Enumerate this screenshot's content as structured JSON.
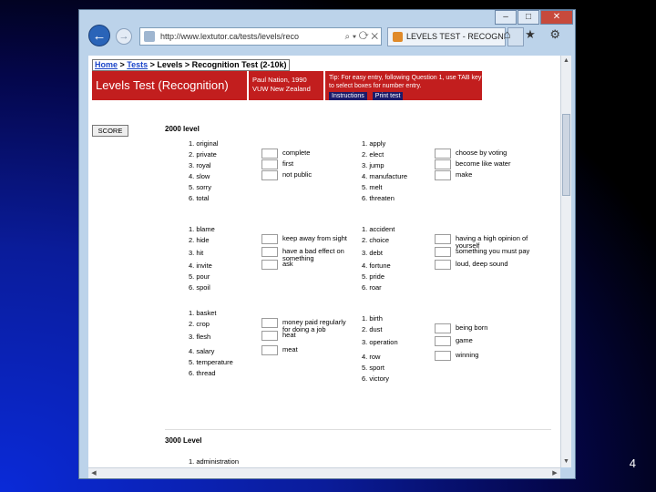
{
  "browser": {
    "caption_buttons": [
      "–",
      "□",
      "✕"
    ],
    "url": "http://www.lextutor.ca/tests/levels/reco",
    "tab_title": "LEVELS TEST - RECOGNI...",
    "tool_icons": "⌂ ★ ⚙"
  },
  "page": {
    "breadcrumb": {
      "home": "Home",
      "tests": "Tests",
      "sep": " > ",
      "rest": "Levels > Recognition Test (2-10k)"
    },
    "title": "Levels Test (Recognition)",
    "author_line1": "Paul Nation, 1990",
    "author_line2": "VUW New Zealand",
    "tip_text": "Tip: For easy entry, following Question 1, use TAB key to select boxes for number entry.",
    "tip_buttons": [
      "Instructions",
      "Print test"
    ],
    "score_button": "SCORE",
    "level1_heading": "2000 level",
    "level2_heading": "3000 Level",
    "level2_first_item": "1. administration"
  },
  "groups": [
    {
      "left_words": [
        "1. original",
        "2. private",
        "3. royal",
        "4. slow",
        "5. sorry",
        "6. total"
      ],
      "left_defs": [
        "complete",
        "first",
        "not public"
      ],
      "right_words": [
        "1. apply",
        "2. elect",
        "3. jump",
        "4. manufacture",
        "5. melt",
        "6. threaten"
      ],
      "right_defs": [
        "choose by voting",
        "become like water",
        "make"
      ]
    },
    {
      "left_words": [
        "1. blame",
        "2. hide",
        "3. hit",
        "4. invite",
        "5. pour",
        "6. spoil"
      ],
      "left_defs": [
        "keep away from sight",
        "have a bad effect on something",
        "ask"
      ],
      "right_words": [
        "1. accident",
        "2. choice",
        "3. debt",
        "4. fortune",
        "5. pride",
        "6. roar"
      ],
      "right_defs": [
        "having a high opinion of yourself",
        "something you must pay",
        "loud, deep sound"
      ]
    },
    {
      "left_words": [
        "1. basket",
        "2. crop",
        "3. flesh",
        "4. salary",
        "5. temperature",
        "6. thread"
      ],
      "left_defs": [
        "money paid regularly for doing a job",
        "heat",
        "meat"
      ],
      "right_words": [
        "1. birth",
        "2. dust",
        "3. operation",
        "4. row",
        "5. sport",
        "6. victory"
      ],
      "right_defs": [
        "being born",
        "game",
        "winning"
      ]
    }
  ],
  "slide_number": "4"
}
